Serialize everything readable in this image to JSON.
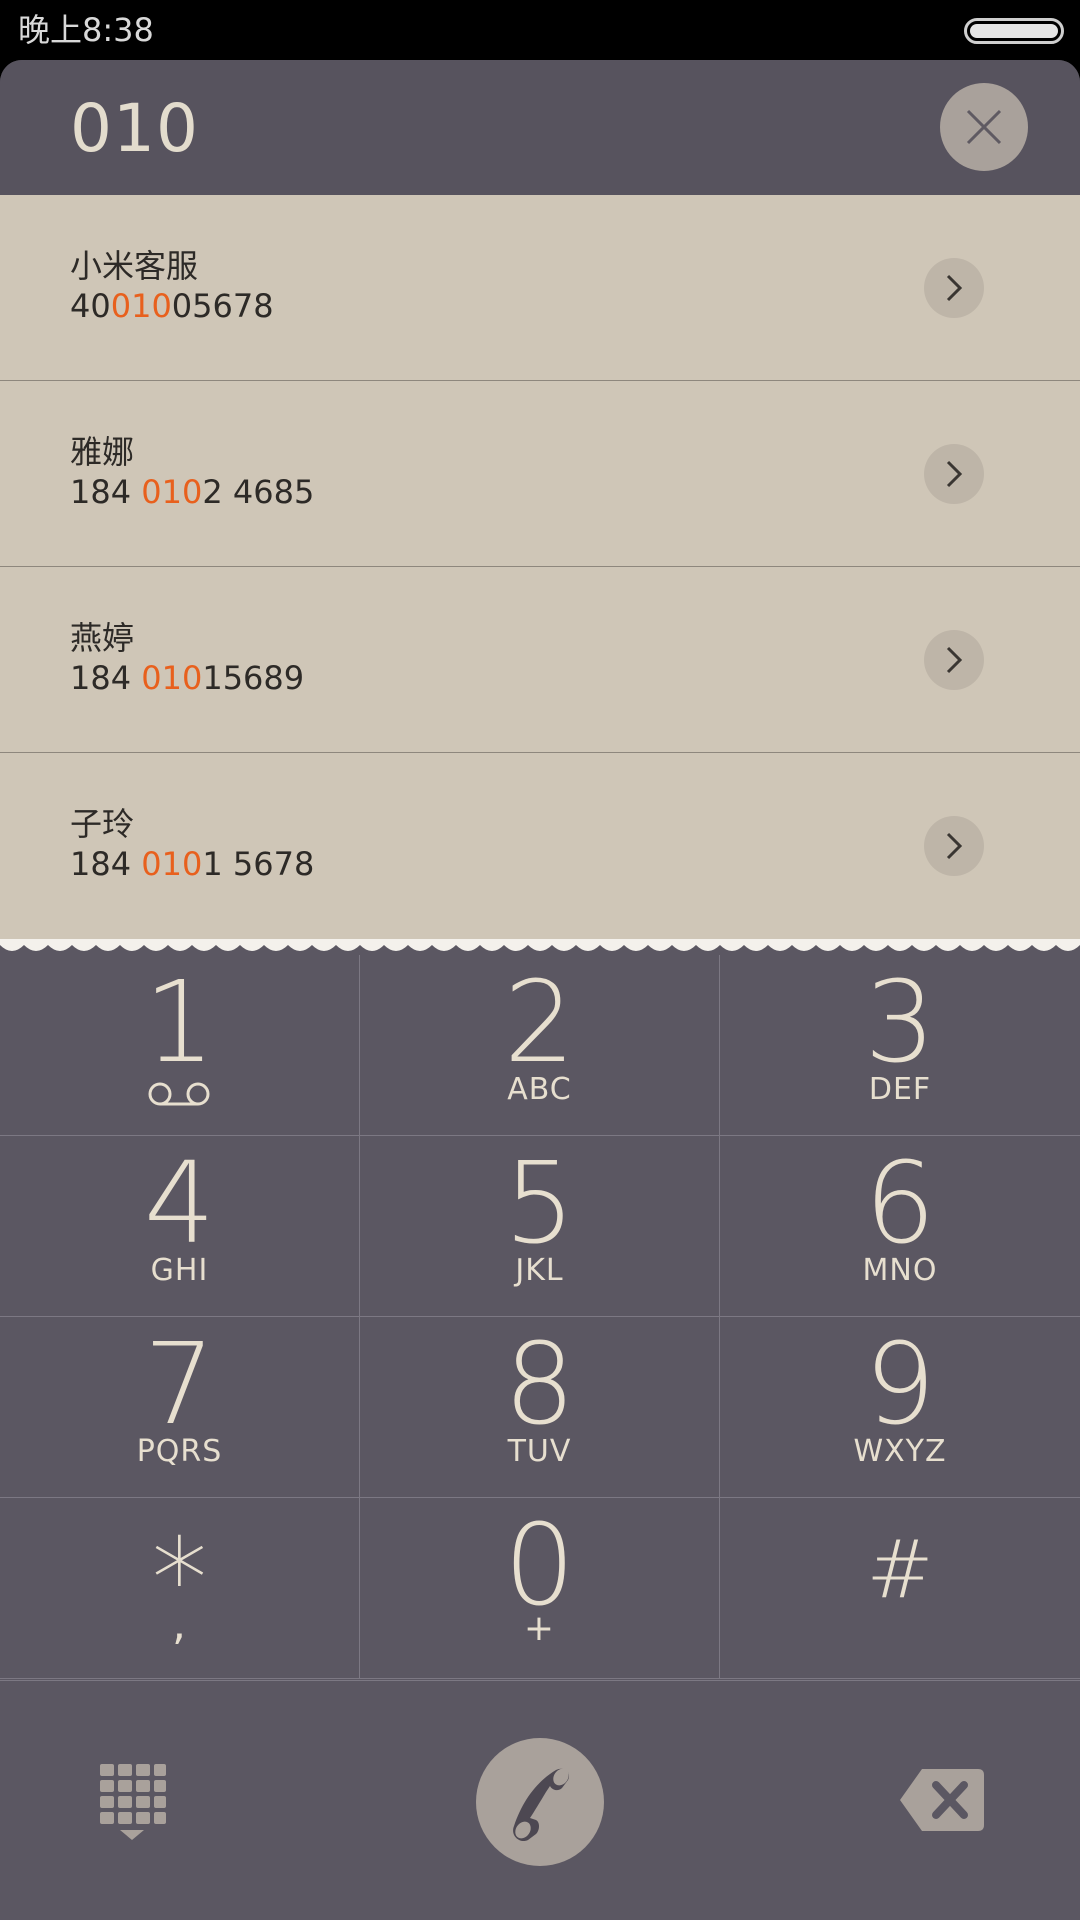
{
  "status_bar": {
    "time": "晚上8:38",
    "battery_level": 1.0
  },
  "dialer": {
    "input": "010"
  },
  "results": [
    {
      "name": "小米客服",
      "number_pre": "40",
      "number_hl": "010",
      "number_post": "05678"
    },
    {
      "name": "雅娜",
      "number_pre": "184 ",
      "number_hl": "010",
      "number_post": "2 4685"
    },
    {
      "name": "燕婷",
      "number_pre": "184 ",
      "number_hl": "010",
      "number_post": "15689"
    },
    {
      "name": "子玲",
      "number_pre": "184 ",
      "number_hl": "010",
      "number_post": "1 5678"
    }
  ],
  "keypad": [
    {
      "digit": "1",
      "letters": ""
    },
    {
      "digit": "2",
      "letters": "ABC"
    },
    {
      "digit": "3",
      "letters": "DEF"
    },
    {
      "digit": "4",
      "letters": "GHI"
    },
    {
      "digit": "5",
      "letters": "JKL"
    },
    {
      "digit": "6",
      "letters": "MNO"
    },
    {
      "digit": "7",
      "letters": "PQRS"
    },
    {
      "digit": "8",
      "letters": "TUV"
    },
    {
      "digit": "9",
      "letters": "WXYZ"
    },
    {
      "digit": "*",
      "letters": ","
    },
    {
      "digit": "0",
      "letters": "+"
    },
    {
      "digit": "#",
      "letters": ""
    }
  ],
  "icons": {
    "clear": "close-icon",
    "row_action": "chevron-right-icon",
    "voicemail": "voicemail-icon",
    "keypad_toggle": "dialpad-icon",
    "call": "phone-icon",
    "backspace": "backspace-icon"
  },
  "colors": {
    "highlight": "#e8601d",
    "header_bg": "#57535e",
    "results_bg": "#cfc6b7",
    "keypad_bg": "#5b5762",
    "key_text": "#e7dfcf"
  }
}
